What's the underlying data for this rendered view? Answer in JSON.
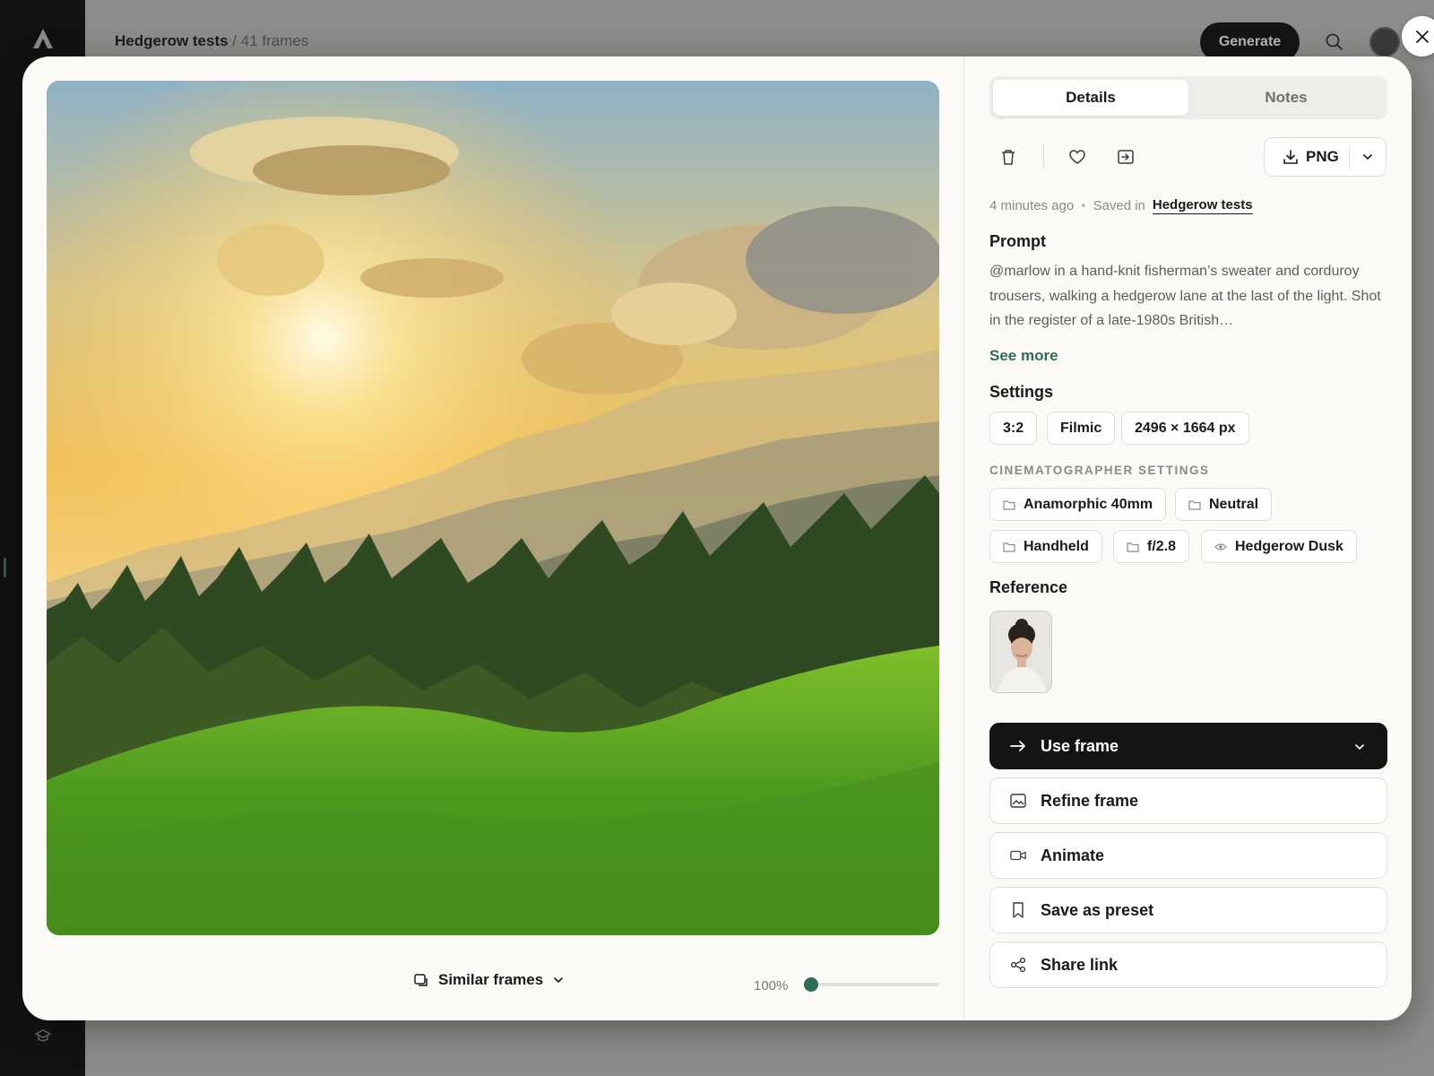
{
  "app": {
    "header_title": "Hedgerow tests",
    "header_subtitle": "/ 41 frames",
    "generate_label": "Generate"
  },
  "modal": {
    "tabs": [
      {
        "label": "Details",
        "active": true
      },
      {
        "label": "Notes",
        "active": false
      }
    ],
    "toolbar": {
      "icons": [
        "trash-icon",
        "heart-icon",
        "move-to-icon"
      ],
      "format_label": "PNG"
    },
    "meta": {
      "time": "4 minutes ago",
      "saved_in_label": "Saved in",
      "collection": "Hedgerow tests"
    },
    "prompt": {
      "title": "Prompt",
      "text": "@marlow in a hand-knit fisherman’s sweater and corduroy trousers, walking a hedgerow lane at the last of the light. Shot in the register of a late-1980s British…",
      "see_more": "See more"
    },
    "settings": {
      "title": "Settings",
      "chips": [
        "3:2",
        "Filmic",
        "2496 × 1664 px"
      ]
    },
    "cinematographer": {
      "title": "CINEMATOGRAPHER SETTINGS",
      "chips": [
        {
          "label": "Anamorphic 40mm",
          "icon": "folder-icon"
        },
        {
          "label": "Neutral",
          "icon": "folder-icon"
        },
        {
          "label": "Handheld",
          "icon": "folder-icon"
        },
        {
          "label": "f/2.8",
          "icon": "folder-icon"
        },
        {
          "label": "Hedgerow Dusk",
          "icon": "eye-icon"
        }
      ]
    },
    "reference": {
      "title": "Reference"
    },
    "actions": [
      {
        "label": "Use frame",
        "icon": "arrow-right-icon",
        "primary": true
      },
      {
        "label": "Refine frame",
        "icon": "image-icon"
      },
      {
        "label": "Animate",
        "icon": "video-icon"
      },
      {
        "label": "Save as preset",
        "icon": "bookmark-icon"
      },
      {
        "label": "Share link",
        "icon": "share-icon"
      }
    ],
    "footer": {
      "similar_frames": "Similar frames",
      "zoom_level": "100%",
      "zoom_fraction": 0
    }
  }
}
